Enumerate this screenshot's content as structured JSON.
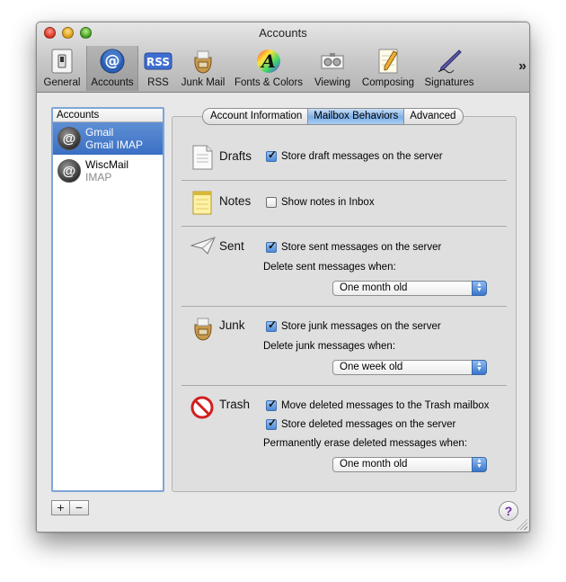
{
  "window": {
    "title": "Accounts"
  },
  "toolbar": {
    "items": [
      {
        "label": "General",
        "icon": "switch-icon"
      },
      {
        "label": "Accounts",
        "icon": "at-icon",
        "selected": true
      },
      {
        "label": "RSS",
        "icon": "rss-icon"
      },
      {
        "label": "Junk Mail",
        "icon": "junk-bag-icon"
      },
      {
        "label": "Fonts & Colors",
        "icon": "color-font-icon"
      },
      {
        "label": "Viewing",
        "icon": "viewing-icon"
      },
      {
        "label": "Composing",
        "icon": "notepad-pencil-icon"
      },
      {
        "label": "Signatures",
        "icon": "pen-icon"
      }
    ],
    "overflow": "»"
  },
  "accounts": {
    "header": "Accounts",
    "items": [
      {
        "name": "Gmail",
        "type": "Gmail IMAP",
        "selected": true
      },
      {
        "name": "WiscMail",
        "type": "IMAP",
        "selected": false
      }
    ],
    "add_label": "+",
    "remove_label": "−"
  },
  "tabs": [
    {
      "label": "Account Information"
    },
    {
      "label": "Mailbox Behaviors",
      "active": true
    },
    {
      "label": "Advanced"
    }
  ],
  "sections": {
    "drafts": {
      "title": "Drafts",
      "store_label": "Store draft messages on the server",
      "store_checked": true
    },
    "notes": {
      "title": "Notes",
      "show_label": "Show notes in Inbox",
      "show_checked": false
    },
    "sent": {
      "title": "Sent",
      "store_label": "Store sent messages on the server",
      "store_checked": true,
      "delete_label": "Delete sent messages when:",
      "delete_value": "One month old"
    },
    "junk": {
      "title": "Junk",
      "store_label": "Store junk messages on the server",
      "store_checked": true,
      "delete_label": "Delete junk messages when:",
      "delete_value": "One week old"
    },
    "trash": {
      "title": "Trash",
      "move_label": "Move deleted messages to the Trash mailbox",
      "move_checked": true,
      "store_label": "Store deleted messages on the server",
      "store_checked": true,
      "erase_label": "Permanently erase deleted messages when:",
      "erase_value": "One month old"
    }
  },
  "help_label": "?",
  "colors": {
    "accent": "#3a6fc4",
    "selection_border": "#7ea6d6"
  }
}
